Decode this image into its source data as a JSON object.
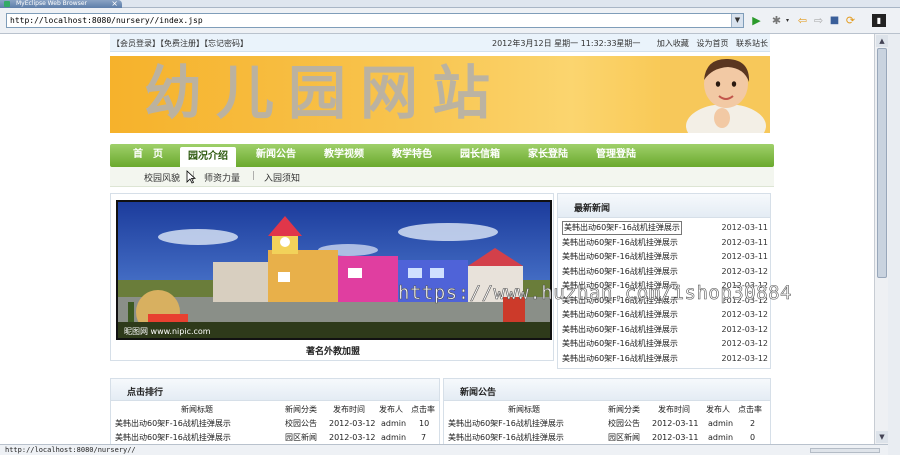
{
  "browser": {
    "tab_title": "MyEclipse Web Browser",
    "url": "http://localhost:8080/nursery//index.jsp",
    "status_url": "http://localhost:8080/nursery//"
  },
  "topbar": {
    "login": "【会员登录】",
    "register": "【免费注册】",
    "forgot": "【忘记密码】",
    "datetime": "2012年3月12日 星期一 11:32:33",
    "weekday": "星期一",
    "favorite": "加入收藏",
    "homepage": "设为首页",
    "contact": "联系站长"
  },
  "banner": {
    "title": "幼儿园网站"
  },
  "nav": {
    "items": [
      {
        "label": "首　页"
      },
      {
        "label": "园况介绍"
      },
      {
        "label": "新闻公告"
      },
      {
        "label": "教学视频"
      },
      {
        "label": "教学特色"
      },
      {
        "label": "园长信箱"
      },
      {
        "label": "家长登陆"
      },
      {
        "label": "管理登陆"
      }
    ],
    "active_index": 1
  },
  "subnav": {
    "items": [
      {
        "label": "校园风貌"
      },
      {
        "label": "师资力量"
      },
      {
        "label": "入园须知"
      }
    ]
  },
  "featured": {
    "caption": "著名外教加盟",
    "image_text": "昵图网 www.nipic.com"
  },
  "latest_news": {
    "title": "最新新闻",
    "items": [
      {
        "title": "美韩出动60架F-16战机挂弹展示",
        "date": "2012-03-11"
      },
      {
        "title": "美韩出动60架F-16战机挂弹展示",
        "date": "2012-03-11"
      },
      {
        "title": "美韩出动60架F-16战机挂弹展示",
        "date": "2012-03-11"
      },
      {
        "title": "美韩出动60架F-16战机挂弹展示",
        "date": "2012-03-12"
      },
      {
        "title": "美韩出动60架F-16战机挂弹展示",
        "date": "2012-03-12"
      },
      {
        "title": "美韩出动60架F-16战机挂弹展示",
        "date": "2012-03-12"
      },
      {
        "title": "美韩出动60架F-16战机挂弹展示",
        "date": "2012-03-12"
      },
      {
        "title": "美韩出动60架F-16战机挂弹展示",
        "date": "2012-03-12"
      },
      {
        "title": "美韩出动60架F-16战机挂弹展示",
        "date": "2012-03-12"
      },
      {
        "title": "美韩出动60架F-16战机挂弹展示",
        "date": "2012-03-12"
      }
    ]
  },
  "click_rank": {
    "title": "点击排行",
    "headers": [
      "新闻标题",
      "新闻分类",
      "发布时间",
      "发布人",
      "点击率"
    ],
    "rows": [
      [
        "美韩出动60架F-16战机挂弹展示",
        "校园公告",
        "2012-03-12",
        "admin",
        "10"
      ],
      [
        "美韩出动60架F-16战机挂弹展示",
        "园区新闻",
        "2012-03-12",
        "admin",
        "7"
      ]
    ]
  },
  "news_notice": {
    "title": "新闻公告",
    "headers": [
      "新闻标题",
      "新闻分类",
      "发布时间",
      "发布人",
      "点击率"
    ],
    "rows": [
      [
        "美韩出动60架F-16战机挂弹展示",
        "校园公告",
        "2012-03-11",
        "admin",
        "2"
      ],
      [
        "美韩出动60架F-16战机挂弹展示",
        "园区新闻",
        "2012-03-11",
        "admin",
        "0"
      ]
    ]
  },
  "watermark": "https://www.huzhan.com/ishop30884"
}
